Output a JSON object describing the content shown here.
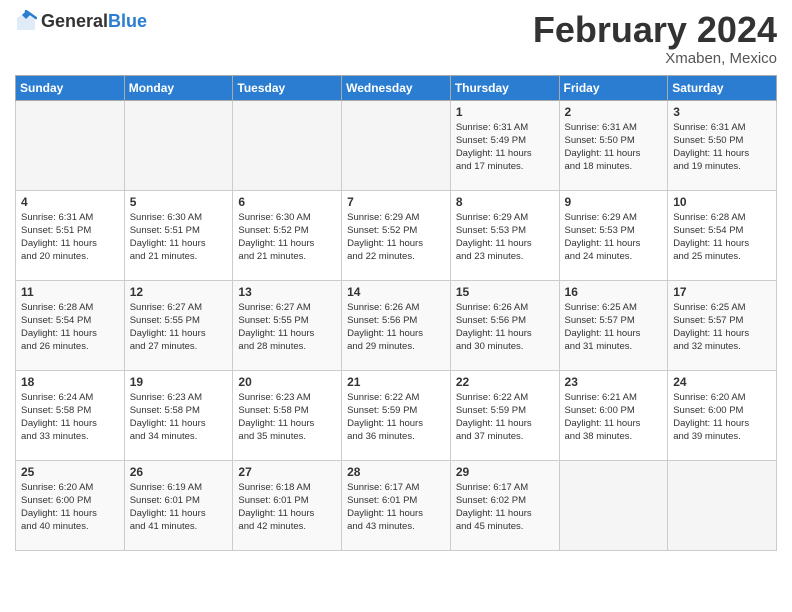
{
  "header": {
    "logo": {
      "general": "General",
      "blue": "Blue"
    },
    "title": "February 2024",
    "subtitle": "Xmaben, Mexico"
  },
  "weekdays": [
    "Sunday",
    "Monday",
    "Tuesday",
    "Wednesday",
    "Thursday",
    "Friday",
    "Saturday"
  ],
  "weeks": [
    [
      {
        "day": "",
        "info": ""
      },
      {
        "day": "",
        "info": ""
      },
      {
        "day": "",
        "info": ""
      },
      {
        "day": "",
        "info": ""
      },
      {
        "day": "1",
        "info": "Sunrise: 6:31 AM\nSunset: 5:49 PM\nDaylight: 11 hours\nand 17 minutes."
      },
      {
        "day": "2",
        "info": "Sunrise: 6:31 AM\nSunset: 5:50 PM\nDaylight: 11 hours\nand 18 minutes."
      },
      {
        "day": "3",
        "info": "Sunrise: 6:31 AM\nSunset: 5:50 PM\nDaylight: 11 hours\nand 19 minutes."
      }
    ],
    [
      {
        "day": "4",
        "info": "Sunrise: 6:31 AM\nSunset: 5:51 PM\nDaylight: 11 hours\nand 20 minutes."
      },
      {
        "day": "5",
        "info": "Sunrise: 6:30 AM\nSunset: 5:51 PM\nDaylight: 11 hours\nand 21 minutes."
      },
      {
        "day": "6",
        "info": "Sunrise: 6:30 AM\nSunset: 5:52 PM\nDaylight: 11 hours\nand 21 minutes."
      },
      {
        "day": "7",
        "info": "Sunrise: 6:29 AM\nSunset: 5:52 PM\nDaylight: 11 hours\nand 22 minutes."
      },
      {
        "day": "8",
        "info": "Sunrise: 6:29 AM\nSunset: 5:53 PM\nDaylight: 11 hours\nand 23 minutes."
      },
      {
        "day": "9",
        "info": "Sunrise: 6:29 AM\nSunset: 5:53 PM\nDaylight: 11 hours\nand 24 minutes."
      },
      {
        "day": "10",
        "info": "Sunrise: 6:28 AM\nSunset: 5:54 PM\nDaylight: 11 hours\nand 25 minutes."
      }
    ],
    [
      {
        "day": "11",
        "info": "Sunrise: 6:28 AM\nSunset: 5:54 PM\nDaylight: 11 hours\nand 26 minutes."
      },
      {
        "day": "12",
        "info": "Sunrise: 6:27 AM\nSunset: 5:55 PM\nDaylight: 11 hours\nand 27 minutes."
      },
      {
        "day": "13",
        "info": "Sunrise: 6:27 AM\nSunset: 5:55 PM\nDaylight: 11 hours\nand 28 minutes."
      },
      {
        "day": "14",
        "info": "Sunrise: 6:26 AM\nSunset: 5:56 PM\nDaylight: 11 hours\nand 29 minutes."
      },
      {
        "day": "15",
        "info": "Sunrise: 6:26 AM\nSunset: 5:56 PM\nDaylight: 11 hours\nand 30 minutes."
      },
      {
        "day": "16",
        "info": "Sunrise: 6:25 AM\nSunset: 5:57 PM\nDaylight: 11 hours\nand 31 minutes."
      },
      {
        "day": "17",
        "info": "Sunrise: 6:25 AM\nSunset: 5:57 PM\nDaylight: 11 hours\nand 32 minutes."
      }
    ],
    [
      {
        "day": "18",
        "info": "Sunrise: 6:24 AM\nSunset: 5:58 PM\nDaylight: 11 hours\nand 33 minutes."
      },
      {
        "day": "19",
        "info": "Sunrise: 6:23 AM\nSunset: 5:58 PM\nDaylight: 11 hours\nand 34 minutes."
      },
      {
        "day": "20",
        "info": "Sunrise: 6:23 AM\nSunset: 5:58 PM\nDaylight: 11 hours\nand 35 minutes."
      },
      {
        "day": "21",
        "info": "Sunrise: 6:22 AM\nSunset: 5:59 PM\nDaylight: 11 hours\nand 36 minutes."
      },
      {
        "day": "22",
        "info": "Sunrise: 6:22 AM\nSunset: 5:59 PM\nDaylight: 11 hours\nand 37 minutes."
      },
      {
        "day": "23",
        "info": "Sunrise: 6:21 AM\nSunset: 6:00 PM\nDaylight: 11 hours\nand 38 minutes."
      },
      {
        "day": "24",
        "info": "Sunrise: 6:20 AM\nSunset: 6:00 PM\nDaylight: 11 hours\nand 39 minutes."
      }
    ],
    [
      {
        "day": "25",
        "info": "Sunrise: 6:20 AM\nSunset: 6:00 PM\nDaylight: 11 hours\nand 40 minutes."
      },
      {
        "day": "26",
        "info": "Sunrise: 6:19 AM\nSunset: 6:01 PM\nDaylight: 11 hours\nand 41 minutes."
      },
      {
        "day": "27",
        "info": "Sunrise: 6:18 AM\nSunset: 6:01 PM\nDaylight: 11 hours\nand 42 minutes."
      },
      {
        "day": "28",
        "info": "Sunrise: 6:17 AM\nSunset: 6:01 PM\nDaylight: 11 hours\nand 43 minutes."
      },
      {
        "day": "29",
        "info": "Sunrise: 6:17 AM\nSunset: 6:02 PM\nDaylight: 11 hours\nand 45 minutes."
      },
      {
        "day": "",
        "info": ""
      },
      {
        "day": "",
        "info": ""
      }
    ]
  ]
}
